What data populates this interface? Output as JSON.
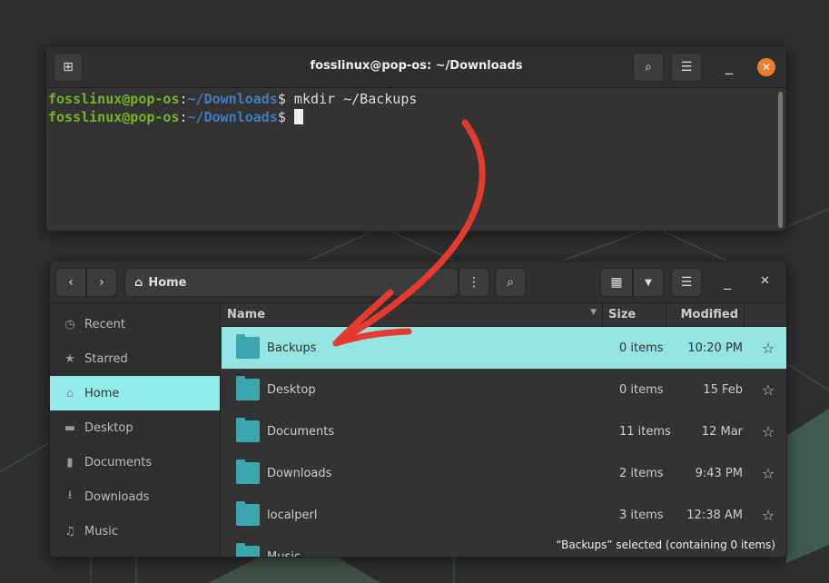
{
  "terminal": {
    "title": "fosslinux@pop-os: ~/Downloads",
    "lines": [
      {
        "user": "fosslinux@pop-os",
        "sep": ":",
        "path": "~/Downloads",
        "prompt": "$",
        "cmd": " mkdir ~/Backups"
      },
      {
        "user": "fosslinux@pop-os",
        "sep": ":",
        "path": "~/Downloads",
        "prompt": "$",
        "cmd": " "
      }
    ]
  },
  "files": {
    "location": "Home",
    "columns": {
      "name": "Name",
      "size": "Size",
      "modified": "Modified"
    },
    "sidebar": [
      {
        "label": "Recent",
        "icon": "clock-icon"
      },
      {
        "label": "Starred",
        "icon": "star-icon"
      },
      {
        "label": "Home",
        "icon": "home-icon",
        "active": true
      },
      {
        "label": "Desktop",
        "icon": "desktop-icon"
      },
      {
        "label": "Documents",
        "icon": "document-icon"
      },
      {
        "label": "Downloads",
        "icon": "download-icon"
      },
      {
        "label": "Music",
        "icon": "music-icon"
      }
    ],
    "rows": [
      {
        "name": "Backups",
        "size": "0 items",
        "modified": "10:20 PM",
        "selected": true
      },
      {
        "name": "Desktop",
        "size": "0 items",
        "modified": "15 Feb"
      },
      {
        "name": "Documents",
        "size": "11 items",
        "modified": "12 Mar"
      },
      {
        "name": "Downloads",
        "size": "2 items",
        "modified": "9:43 PM"
      },
      {
        "name": "localperl",
        "size": "3 items",
        "modified": "12:38 AM"
      },
      {
        "name": "Music",
        "size": "",
        "modified": ""
      }
    ],
    "status": "“Backups” selected  (containing 0 items)"
  },
  "colors": {
    "accent": "#94ebeb",
    "annotation": "#e53b2f",
    "close": "#e8812f"
  }
}
